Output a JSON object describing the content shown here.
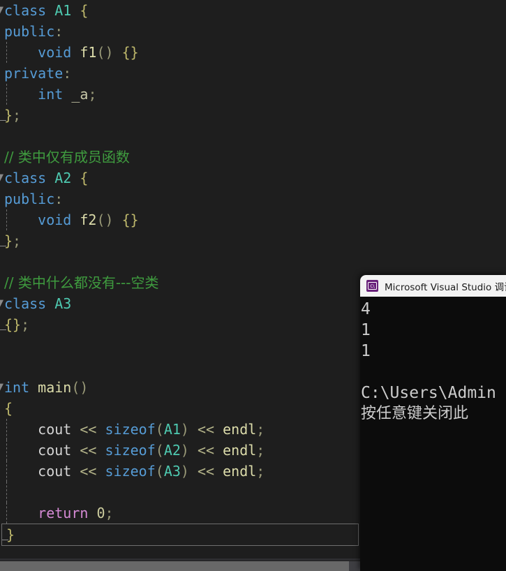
{
  "editor": {
    "background": "#1e1e1e",
    "lines": [
      {
        "id": "l1",
        "fold": "▼",
        "indent": 0,
        "tokens": [
          {
            "t": "class ",
            "c": "kw"
          },
          {
            "t": "A1",
            "c": "type"
          },
          {
            "t": " {",
            "c": "brace"
          }
        ]
      },
      {
        "id": "l2",
        "fold": "",
        "indent": 0,
        "tokens": [
          {
            "t": "public",
            "c": "kw"
          },
          {
            "t": ":",
            "c": "punct"
          }
        ]
      },
      {
        "id": "l3",
        "fold": "",
        "indent": 1,
        "guide": true,
        "tokens": [
          {
            "t": "    ",
            "c": "ident"
          },
          {
            "t": "void ",
            "c": "kw"
          },
          {
            "t": "f1",
            "c": "fn"
          },
          {
            "t": "() ",
            "c": "punct"
          },
          {
            "t": "{}",
            "c": "brace"
          }
        ]
      },
      {
        "id": "l4",
        "fold": "",
        "indent": 0,
        "tokens": [
          {
            "t": "private",
            "c": "kw"
          },
          {
            "t": ":",
            "c": "punct"
          }
        ]
      },
      {
        "id": "l5",
        "fold": "",
        "indent": 1,
        "guide": true,
        "tokens": [
          {
            "t": "    ",
            "c": "ident"
          },
          {
            "t": "int ",
            "c": "kw"
          },
          {
            "t": "_a",
            "c": "var"
          },
          {
            "t": ";",
            "c": "punct"
          }
        ]
      },
      {
        "id": "l6",
        "fold": "",
        "indent": 0,
        "endstub": true,
        "tokens": [
          {
            "t": "}",
            "c": "brace"
          },
          {
            "t": ";",
            "c": "punct"
          }
        ]
      },
      {
        "id": "l7",
        "fold": "",
        "indent": 0,
        "tokens": []
      },
      {
        "id": "l8",
        "fold": "",
        "indent": 0,
        "tokens": [
          {
            "t": "// 类中仅有成员函数",
            "c": "comment"
          }
        ]
      },
      {
        "id": "l9",
        "fold": "▼",
        "indent": 0,
        "tokens": [
          {
            "t": "class ",
            "c": "kw"
          },
          {
            "t": "A2",
            "c": "type"
          },
          {
            "t": " {",
            "c": "brace"
          }
        ]
      },
      {
        "id": "l10",
        "fold": "",
        "indent": 0,
        "tokens": [
          {
            "t": "public",
            "c": "kw"
          },
          {
            "t": ":",
            "c": "punct"
          }
        ]
      },
      {
        "id": "l11",
        "fold": "",
        "indent": 1,
        "guide": true,
        "tokens": [
          {
            "t": "    ",
            "c": "ident"
          },
          {
            "t": "void ",
            "c": "kw"
          },
          {
            "t": "f2",
            "c": "fn"
          },
          {
            "t": "() ",
            "c": "punct"
          },
          {
            "t": "{}",
            "c": "brace"
          }
        ]
      },
      {
        "id": "l12",
        "fold": "",
        "indent": 0,
        "endstub": true,
        "tokens": [
          {
            "t": "}",
            "c": "brace"
          },
          {
            "t": ";",
            "c": "punct"
          }
        ]
      },
      {
        "id": "l13",
        "fold": "",
        "indent": 0,
        "tokens": []
      },
      {
        "id": "l14",
        "fold": "",
        "indent": 0,
        "tokens": [
          {
            "t": "// 类中什么都没有---空类",
            "c": "comment"
          }
        ]
      },
      {
        "id": "l15",
        "fold": "▼",
        "indent": 0,
        "tokens": [
          {
            "t": "class ",
            "c": "kw"
          },
          {
            "t": "A3",
            "c": "type"
          }
        ]
      },
      {
        "id": "l16",
        "fold": "",
        "indent": 0,
        "endstub": true,
        "tokens": [
          {
            "t": "{}",
            "c": "brace"
          },
          {
            "t": ";",
            "c": "punct"
          }
        ]
      },
      {
        "id": "l17",
        "fold": "",
        "indent": 0,
        "tokens": []
      },
      {
        "id": "l18",
        "fold": "",
        "indent": 0,
        "tokens": []
      },
      {
        "id": "l19",
        "fold": "▼",
        "indent": 0,
        "tokens": [
          {
            "t": "int ",
            "c": "kw"
          },
          {
            "t": "main",
            "c": "fn"
          },
          {
            "t": "()",
            "c": "punct"
          }
        ]
      },
      {
        "id": "l20",
        "fold": "",
        "indent": 0,
        "tokens": [
          {
            "t": "{",
            "c": "brace"
          }
        ]
      },
      {
        "id": "l21",
        "fold": "",
        "indent": 1,
        "guide": true,
        "tokens": [
          {
            "t": "    ",
            "c": "ident"
          },
          {
            "t": "cout ",
            "c": "ident"
          },
          {
            "t": "<< ",
            "c": "op"
          },
          {
            "t": "sizeof",
            "c": "kw"
          },
          {
            "t": "(",
            "c": "punct"
          },
          {
            "t": "A1",
            "c": "type"
          },
          {
            "t": ") ",
            "c": "punct"
          },
          {
            "t": "<< ",
            "c": "op"
          },
          {
            "t": "endl",
            "c": "fn"
          },
          {
            "t": ";",
            "c": "punct"
          }
        ]
      },
      {
        "id": "l22",
        "fold": "",
        "indent": 1,
        "guide": true,
        "tokens": [
          {
            "t": "    ",
            "c": "ident"
          },
          {
            "t": "cout ",
            "c": "ident"
          },
          {
            "t": "<< ",
            "c": "op"
          },
          {
            "t": "sizeof",
            "c": "kw"
          },
          {
            "t": "(",
            "c": "punct"
          },
          {
            "t": "A2",
            "c": "type"
          },
          {
            "t": ") ",
            "c": "punct"
          },
          {
            "t": "<< ",
            "c": "op"
          },
          {
            "t": "endl",
            "c": "fn"
          },
          {
            "t": ";",
            "c": "punct"
          }
        ]
      },
      {
        "id": "l23",
        "fold": "",
        "indent": 1,
        "guide": true,
        "tokens": [
          {
            "t": "    ",
            "c": "ident"
          },
          {
            "t": "cout ",
            "c": "ident"
          },
          {
            "t": "<< ",
            "c": "op"
          },
          {
            "t": "sizeof",
            "c": "kw"
          },
          {
            "t": "(",
            "c": "punct"
          },
          {
            "t": "A3",
            "c": "type"
          },
          {
            "t": ") ",
            "c": "punct"
          },
          {
            "t": "<< ",
            "c": "op"
          },
          {
            "t": "endl",
            "c": "fn"
          },
          {
            "t": ";",
            "c": "punct"
          }
        ]
      },
      {
        "id": "l24",
        "fold": "",
        "indent": 1,
        "guide": true,
        "tokens": []
      },
      {
        "id": "l25",
        "fold": "",
        "indent": 1,
        "guide": true,
        "tokens": [
          {
            "t": "    ",
            "c": "ident"
          },
          {
            "t": "return ",
            "c": "ctrl"
          },
          {
            "t": "0",
            "c": "num"
          },
          {
            "t": ";",
            "c": "punct"
          }
        ]
      },
      {
        "id": "l26",
        "fold": "",
        "indent": 0,
        "current": true,
        "endstub": true,
        "tokens": [
          {
            "t": "}",
            "c": "brace"
          }
        ]
      }
    ]
  },
  "console": {
    "title": "Microsoft Visual Studio 调试控制台",
    "icon": "console-app-icon",
    "background": "#0c0c0c",
    "titlebar_background": "#f3f3f3",
    "lines": [
      {
        "text": "4",
        "cjk": false
      },
      {
        "text": "1",
        "cjk": false
      },
      {
        "text": "1",
        "cjk": false
      },
      {
        "text": "",
        "cjk": false
      },
      {
        "text": "C:\\Users\\Admin",
        "cjk": false
      },
      {
        "text": "按任意键关闭此",
        "cjk": true
      }
    ]
  },
  "scrollbar": {
    "name": "horizontal-scrollbar"
  }
}
